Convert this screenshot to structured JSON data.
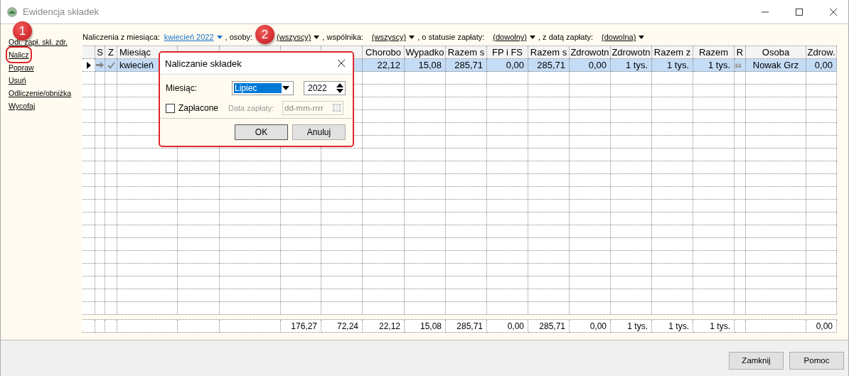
{
  "window": {
    "title": "Ewidencja składek"
  },
  "sidebar": {
    "items": [
      {
        "label": "Odl. zapł. skł. zdr.",
        "highlighted": false
      },
      {
        "label": "Nalicz",
        "highlighted": true
      },
      {
        "label": "Popraw",
        "highlighted": false
      },
      {
        "label": "Usuń",
        "highlighted": false
      },
      {
        "label": "Odliczenie/obniżka",
        "highlighted": false
      },
      {
        "label": "Wycofaj",
        "highlighted": false
      }
    ]
  },
  "filters": [
    {
      "prefix": "Naliczenia z miesiąca:",
      "value": "kwiecień 2022",
      "kind": "link"
    },
    {
      "prefix": ", osoby:",
      "value": "(wszyscy)",
      "kind": "plain"
    },
    {
      "prefix": ", wspólnika:",
      "value": "(wszyscy)",
      "kind": "plain"
    },
    {
      "prefix": ", o statusie zapłaty:",
      "value": "(dowolny)",
      "kind": "plain"
    },
    {
      "prefix": ", z datą zapłaty:",
      "value": "(dowolna)",
      "kind": "plain"
    }
  ],
  "table": {
    "columns": [
      {
        "kind": "pointer"
      },
      {
        "label": "S",
        "kind": "arrow"
      },
      {
        "label": "Z",
        "kind": "check"
      },
      {
        "label": "Miesiąc",
        "kind": "text"
      },
      {
        "kind": "text"
      },
      {
        "kind": "text"
      },
      {
        "kind": "text"
      },
      {
        "kind": "text"
      },
      {
        "label": "Chorobo",
        "kind": "text"
      },
      {
        "label": "Wypadko",
        "kind": "text"
      },
      {
        "label": "Razem s",
        "kind": "text"
      },
      {
        "label": "FP i FS",
        "kind": "text"
      },
      {
        "label": "Razem s",
        "kind": "text"
      },
      {
        "label": "Zdrowotn",
        "kind": "text"
      },
      {
        "label": "Zdrowotn",
        "kind": "text"
      },
      {
        "label": "Razem z",
        "kind": "text"
      },
      {
        "label": "Razem",
        "kind": "text"
      },
      {
        "label": "R",
        "kind": "people"
      },
      {
        "label": "Osoba",
        "kind": "text"
      },
      {
        "label": "Zdrow.",
        "kind": "text"
      }
    ],
    "rows": [
      {
        "selected": true,
        "cells": [
          "",
          "",
          "",
          "kwiecień",
          "",
          "",
          "",
          "",
          "22,12",
          "15,08",
          "285,71",
          "0,00",
          "285,71",
          "0,00",
          "1 tys.",
          "1 tys.",
          "1 tys.",
          "",
          "Nowak Grz",
          "0,00"
        ]
      }
    ],
    "totals": {
      "cells": [
        "",
        "",
        "",
        "",
        "",
        "",
        "176,27",
        "72,24",
        "22,12",
        "15,08",
        "285,71",
        "0,00",
        "285,71",
        "0,00",
        "1 tys.",
        "1 tys.",
        "1 tys.",
        "",
        "",
        "0,00"
      ]
    }
  },
  "dialog": {
    "title": "Naliczanie składek",
    "month_label": "Miesiąc:",
    "month": "Lipiec",
    "year": "2022",
    "paid": {
      "label": "Zapłacone",
      "checked": false
    },
    "date_label": "Data zapłaty:",
    "date_placeholder": "dd-mm-rrrr",
    "date_disabled": true,
    "buttons": [
      {
        "label": "OK",
        "default": true
      },
      {
        "label": "Anuluj",
        "default": false
      }
    ]
  },
  "callouts": [
    "1",
    "2"
  ],
  "buttons": [
    "Zamknij",
    "Pomoc"
  ]
}
